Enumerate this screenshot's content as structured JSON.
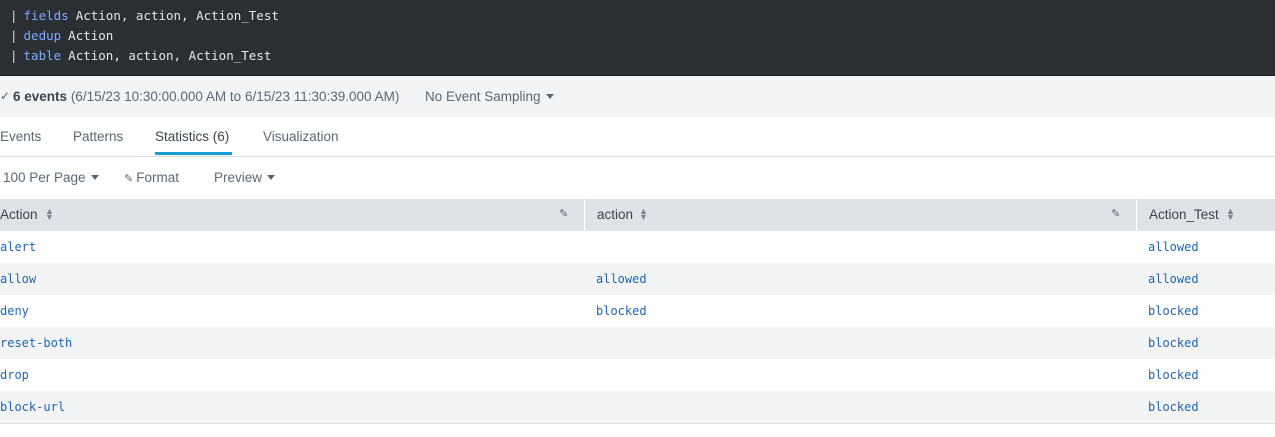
{
  "search": {
    "lines": [
      {
        "pipe": "|",
        "command": "fields",
        "args": "Action, action, Action_Test"
      },
      {
        "pipe": "|",
        "command": "dedup",
        "args": "Action"
      },
      {
        "pipe": "|",
        "command": "table",
        "args": "Action, action, Action_Test"
      }
    ]
  },
  "status": {
    "check": "✓",
    "event_count": "6 events",
    "time_range": "(6/15/23 10:30:00.000 AM to 6/15/23 11:30:39.000 AM)",
    "sampling": "No Event Sampling"
  },
  "tabs": [
    {
      "label": "Events",
      "active": false
    },
    {
      "label": "Patterns",
      "active": false
    },
    {
      "label": "Statistics (6)",
      "active": true
    },
    {
      "label": "Visualization",
      "active": false
    }
  ],
  "toolbar": {
    "per_page": "100 Per Page",
    "format": "Format",
    "preview": "Preview"
  },
  "table": {
    "columns": [
      "Action",
      "action",
      "Action_Test"
    ],
    "rows": [
      [
        "alert",
        "",
        "allowed"
      ],
      [
        "allow",
        "allowed",
        "allowed"
      ],
      [
        "deny",
        "blocked",
        "blocked"
      ],
      [
        "reset-both",
        "",
        "blocked"
      ],
      [
        "drop",
        "",
        "blocked"
      ],
      [
        "block-url",
        "",
        "blocked"
      ]
    ]
  },
  "colors": {
    "editor_bg": "#2b2f33",
    "command": "#7fa8ff",
    "link": "#2166b3",
    "active_tab": "#1a9bd7"
  }
}
